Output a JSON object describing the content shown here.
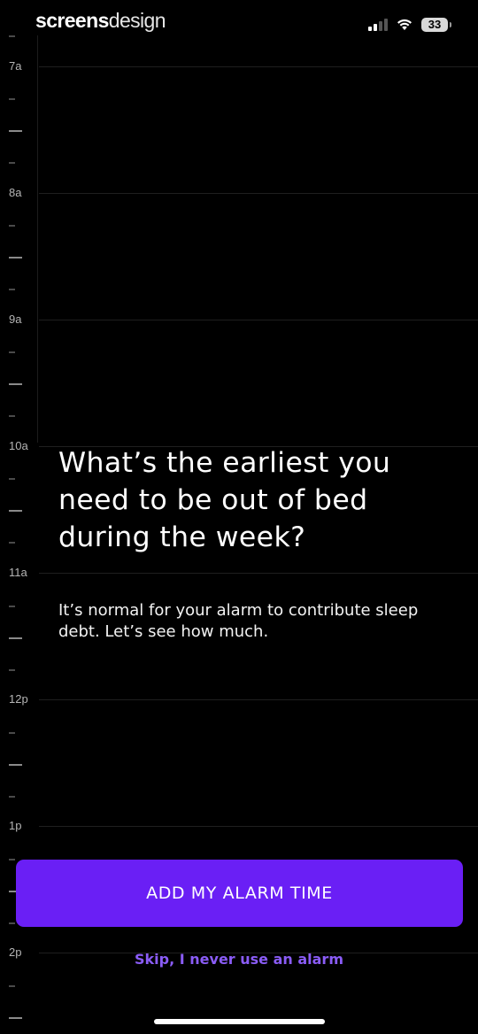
{
  "status_bar": {
    "brand_bold": "screens",
    "brand_light": "design",
    "battery_level": "33",
    "signal_bars_filled": 2,
    "signal_bars_total": 4
  },
  "timeline": {
    "hours": [
      "7a",
      "8a",
      "9a",
      "10a",
      "11a",
      "12p",
      "1p",
      "2p"
    ]
  },
  "content": {
    "question": "What’s the earliest you need to be out of bed during the week?",
    "subtext": "It’s normal for your alarm to contribute sleep debt. Let’s see how much."
  },
  "actions": {
    "primary_label": "ADD MY ALARM TIME",
    "skip_label": "Skip, I never use an alarm"
  },
  "colors": {
    "accent": "#6a1ff5",
    "link": "#8a5cf6",
    "background": "#000000"
  }
}
